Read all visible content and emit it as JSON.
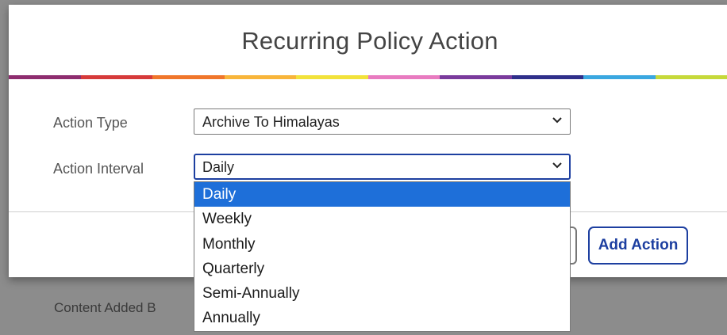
{
  "backdrop": {
    "partial_text": "Content Added B"
  },
  "dialog": {
    "title": "Recurring Policy Action",
    "strip_colors": [
      "#8e2d6f",
      "#d63a3a",
      "#f0762b",
      "#f8b53a",
      "#f2e23b",
      "#e87bc0",
      "#7a3b9c",
      "#2f2f8a",
      "#3aa7e0",
      "#c6d93a"
    ],
    "action_type": {
      "label": "Action Type",
      "value": "Archive To Himalayas"
    },
    "action_interval": {
      "label": "Action Interval",
      "value": "Daily",
      "options": [
        "Daily",
        "Weekly",
        "Monthly",
        "Quarterly",
        "Semi-Annually",
        "Annually"
      ],
      "selected_index": 0
    },
    "add_action_label": "Add Action"
  }
}
